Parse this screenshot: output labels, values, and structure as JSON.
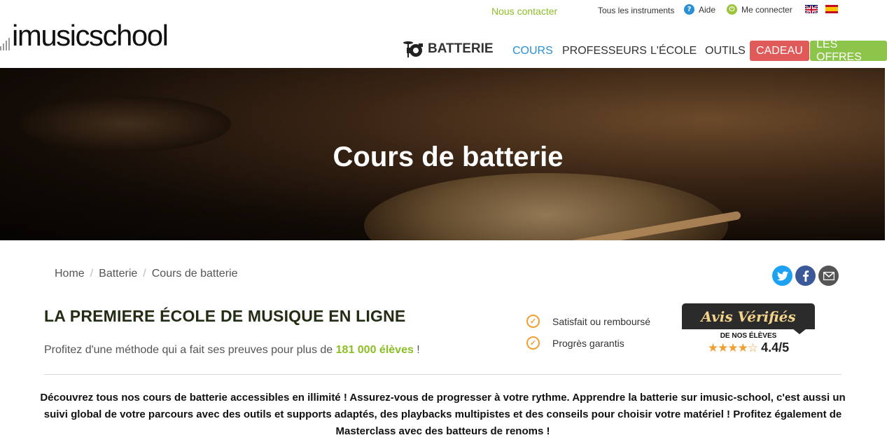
{
  "topbar": {
    "contact": "Nous contacter",
    "instruments": "Tous les instruments",
    "help": "Aide",
    "login": "Me connecter"
  },
  "logo": {
    "text": "imusicschool"
  },
  "nav": {
    "instrument": "BATTERIE",
    "items": [
      "COURS",
      "PROFESSEURS",
      "L'ÉCOLE",
      "OUTILS"
    ],
    "active_index": 0,
    "gift": "CADEAU",
    "offers": "LES OFFRES"
  },
  "hero": {
    "title": "Cours de batterie"
  },
  "breadcrumb": [
    "Home",
    "Batterie",
    "Cours de batterie"
  ],
  "intro": {
    "headline": "LA PREMIERE ÉCOLE DE MUSIQUE EN LIGNE",
    "subtitle_before": "Profitez d'une méthode qui a fait ses preuves pour plus de ",
    "subtitle_highlight": "181 000 élèves",
    "subtitle_after": " !"
  },
  "guarantees": [
    "Satisfait ou remboursé",
    "Progrès garantis"
  ],
  "reviews": {
    "brand": "Avis Vérifiés",
    "caption": "DE NOS ÉLÈVES",
    "score": "4.4/5",
    "rating": 4.4
  },
  "description": "Découvrez tous nos cours de batterie accessibles en illimité ! Assurez-vous de progresser à votre rythme. Apprendre la batterie sur imusic-school, c'est aussi un suivi global de votre parcours avec des outils et supports adaptés, des playbacks multipistes et des conseils pour choisir votre matériel ! Profitez également de Masterclass avec des batteurs  de renoms !",
  "colors": {
    "accent_green": "#8cbf26",
    "accent_blue": "#2a8fd4",
    "gift_red": "#e05a5a",
    "offers_green": "#8dc44a",
    "star_orange": "#f0a030"
  },
  "icons": [
    "help-icon",
    "power-icon",
    "uk-flag-icon",
    "spain-flag-icon",
    "drum-icon",
    "twitter-icon",
    "facebook-icon",
    "mail-icon",
    "check-circle-icon",
    "star-icon"
  ]
}
